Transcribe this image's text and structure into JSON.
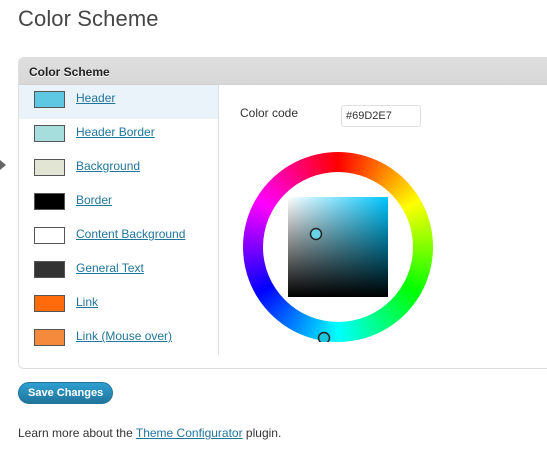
{
  "page": {
    "title": "Color Scheme"
  },
  "panel": {
    "header": "Color Scheme"
  },
  "sidebar": {
    "active_index": 0,
    "items": [
      {
        "label": "Header",
        "color": "#5EC8E2"
      },
      {
        "label": "Header Border",
        "color": "#A6DEDE"
      },
      {
        "label": "Background",
        "color": "#E2E5D4"
      },
      {
        "label": "Border",
        "color": "#000000"
      },
      {
        "label": "Content Background",
        "color": "#FFFFFF"
      },
      {
        "label": "General Text",
        "color": "#333333"
      },
      {
        "label": "Link",
        "color": "#FF6A0A"
      },
      {
        "label": "Link (Mouse over)",
        "color": "#F5893C"
      }
    ]
  },
  "picker": {
    "label": "Color code",
    "value": "#69D2E7",
    "hue_color": "#00C6FF"
  },
  "actions": {
    "save_label": "Save Changes"
  },
  "footer": {
    "prefix": "Learn more about the ",
    "link_text": "Theme Configurator",
    "suffix": " plugin."
  },
  "icons": {
    "left_arrow": "left-pointer-arrow-icon"
  }
}
